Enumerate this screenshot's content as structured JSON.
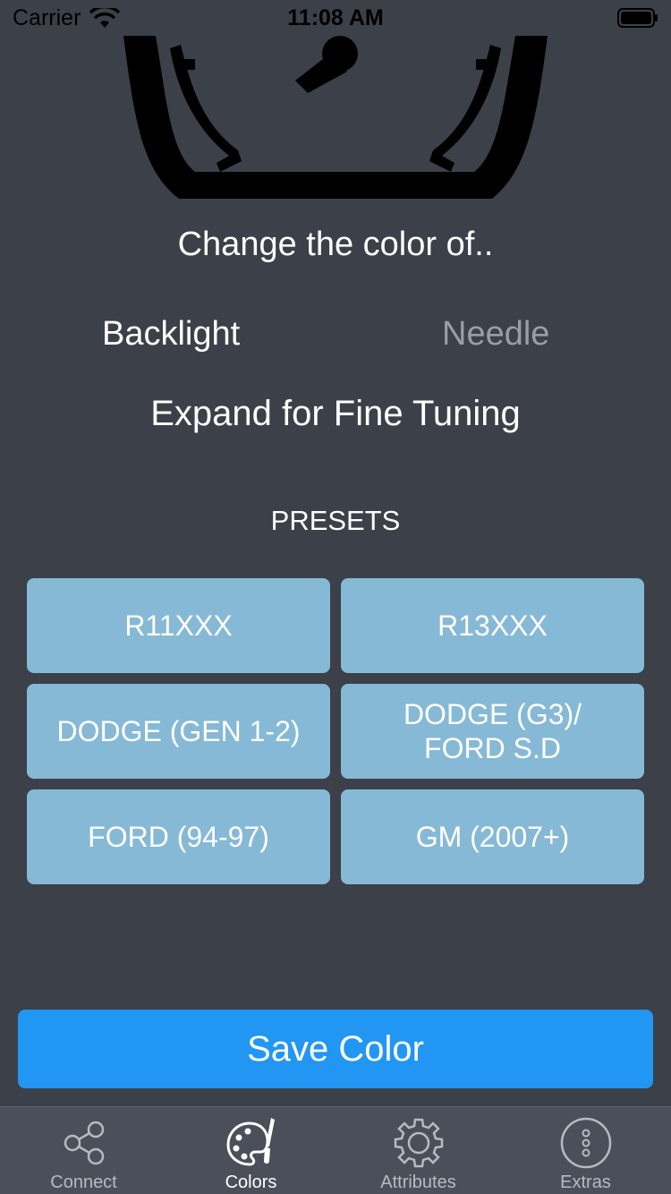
{
  "status_bar": {
    "carrier": "Carrier",
    "time": "11:08 AM"
  },
  "title": "Change the color of..",
  "segments": {
    "backlight": "Backlight",
    "needle": "Needle",
    "selected": "Backlight"
  },
  "expand_label": "Expand for Fine Tuning",
  "presets": {
    "title": "PRESETS",
    "items": [
      {
        "label": "R11XXX"
      },
      {
        "label": "R13XXX"
      },
      {
        "label": "DODGE (GEN 1-2)"
      },
      {
        "label": "DODGE (G3)/ FORD S.D"
      },
      {
        "label": "FORD (94-97)"
      },
      {
        "label": "GM (2007+)"
      }
    ]
  },
  "save_label": "Save Color",
  "tabs": [
    {
      "label": "Connect",
      "icon": "share-icon"
    },
    {
      "label": "Colors",
      "icon": "palette-icon",
      "active": true
    },
    {
      "label": "Attributes",
      "icon": "gear-icon"
    },
    {
      "label": "Extras",
      "icon": "more-icon"
    }
  ],
  "colors": {
    "background": "#3b4049",
    "preset_button": "#86b9d6",
    "save_button": "#2196f3",
    "tab_bar": "#4a4f59"
  }
}
